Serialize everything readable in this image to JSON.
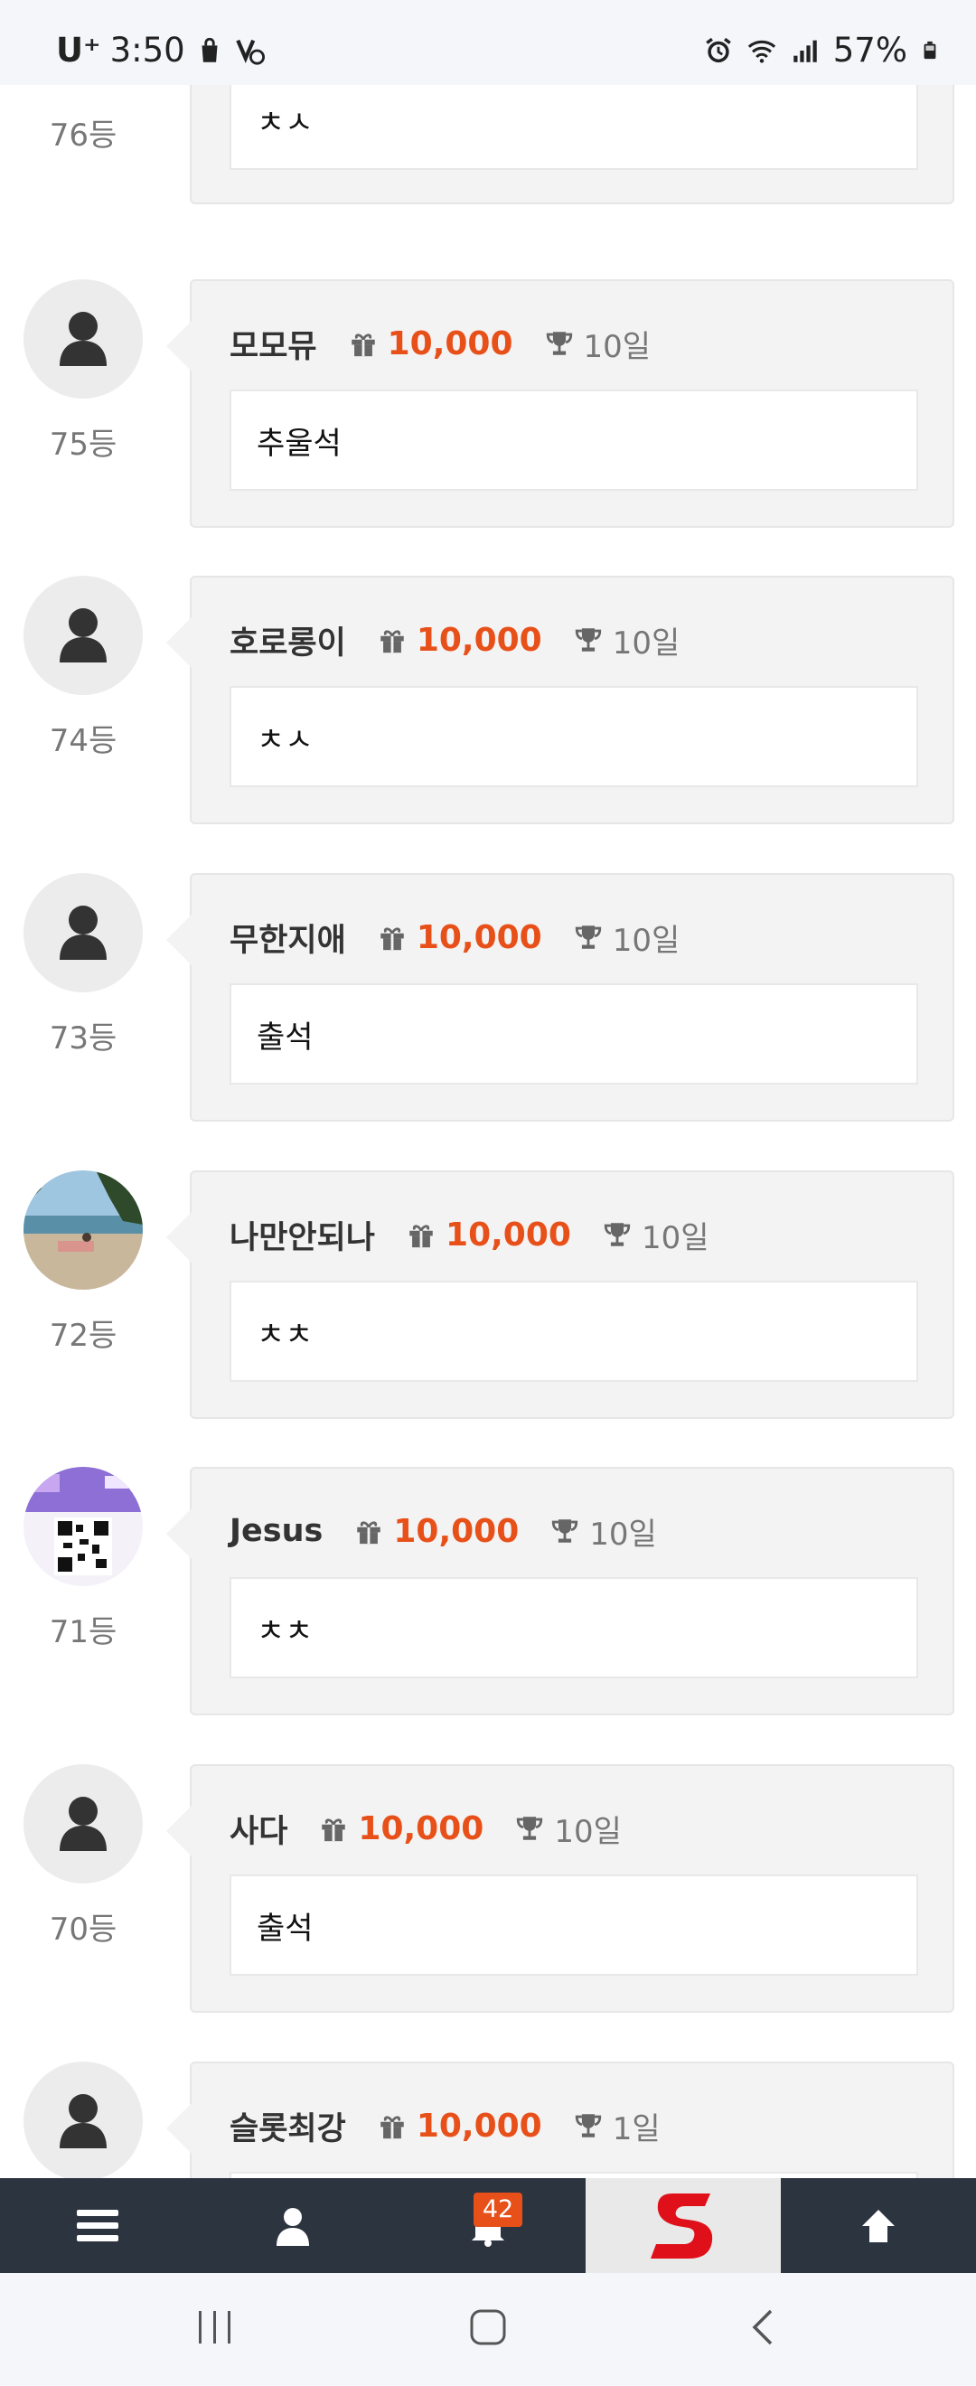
{
  "status_bar": {
    "carrier": "U⁺",
    "time": "3:50",
    "battery": "57%"
  },
  "entries": [
    {
      "rank": "76등",
      "name": "",
      "points": "",
      "days": "",
      "message": "ㅊㅅ",
      "avatar": "default"
    },
    {
      "rank": "75등",
      "name": "모모뮤",
      "points": "10,000",
      "days": "10일",
      "message": "추울석",
      "avatar": "default"
    },
    {
      "rank": "74등",
      "name": "호로롱이",
      "points": "10,000",
      "days": "10일",
      "message": "ㅊㅅ",
      "avatar": "default"
    },
    {
      "rank": "73등",
      "name": "무한지애",
      "points": "10,000",
      "days": "10일",
      "message": "출석",
      "avatar": "default"
    },
    {
      "rank": "72등",
      "name": "나만안되나",
      "points": "10,000",
      "days": "10일",
      "message": "ㅊㅊ",
      "avatar": "beach-photo"
    },
    {
      "rank": "71등",
      "name": "Jesus",
      "points": "10,000",
      "days": "10일",
      "message": "ㅊㅊ",
      "avatar": "qr-photo"
    },
    {
      "rank": "70등",
      "name": "사다",
      "points": "10,000",
      "days": "10일",
      "message": "출석",
      "avatar": "default"
    },
    {
      "rank": "",
      "name": "슬롯최강",
      "points": "10,000",
      "days": "1일",
      "message": "",
      "avatar": "default"
    }
  ],
  "bottom_nav": {
    "items": [
      "menu-icon",
      "user-icon",
      "bell-icon",
      "site-logo",
      "arrow-up-icon"
    ],
    "notification_count": "42"
  },
  "colors": {
    "points": "#e8501a",
    "nav_bg": "#2c3440",
    "bubble_bg": "#f3f3f3"
  }
}
